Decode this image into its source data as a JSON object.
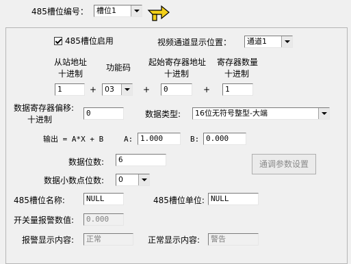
{
  "top": {
    "slot_number_label": "485槽位编号：",
    "slot_number_value": "槽位1"
  },
  "panel": {
    "enable_label": "485槽位启用",
    "enable_checked": true,
    "video_channel_label": "视频通道显示位置：",
    "video_channel_value": "通道1",
    "slave_addr_label_1": "从站地址",
    "slave_addr_label_2": "十进制",
    "function_code_label": "功能码",
    "start_reg_label_1": "起始寄存器地址",
    "start_reg_label_2": "十进制",
    "reg_count_label_1": "寄存器数量",
    "reg_count_label_2": "十进制",
    "plus": "+",
    "slave_addr_value": "1",
    "function_code_value": "03",
    "start_reg_value": "0",
    "reg_count_value": "1",
    "offset_label_1": "数据寄存器偏移:",
    "offset_label_2": "十进制",
    "offset_value": "0",
    "data_type_label": "数据类型:",
    "data_type_value": "16位无符号整型-大端",
    "output_formula": "输出 =  A*X + B",
    "a_label": "A:",
    "a_value": "1.000",
    "b_label": "B:",
    "b_value": "0.000",
    "digits_label": "数据位数:",
    "digits_value": "6",
    "tune_button": "通调参数设置",
    "decimals_label": "数据小数点位数:",
    "decimals_value": "0",
    "slot_name_label": "485槽位名称:",
    "slot_name_value": "NULL",
    "slot_unit_label": "485槽位单位:",
    "slot_unit_value": "NULL",
    "alarm_value_label": "开关量报警数值:",
    "alarm_value_value": "0.000",
    "alarm_display_label": "报警显示内容:",
    "alarm_display_value": "正常",
    "normal_display_label": "正常显示内容:",
    "normal_display_value": "警告"
  },
  "icons": {
    "hand_pointer": "hand-pointer-icon"
  }
}
